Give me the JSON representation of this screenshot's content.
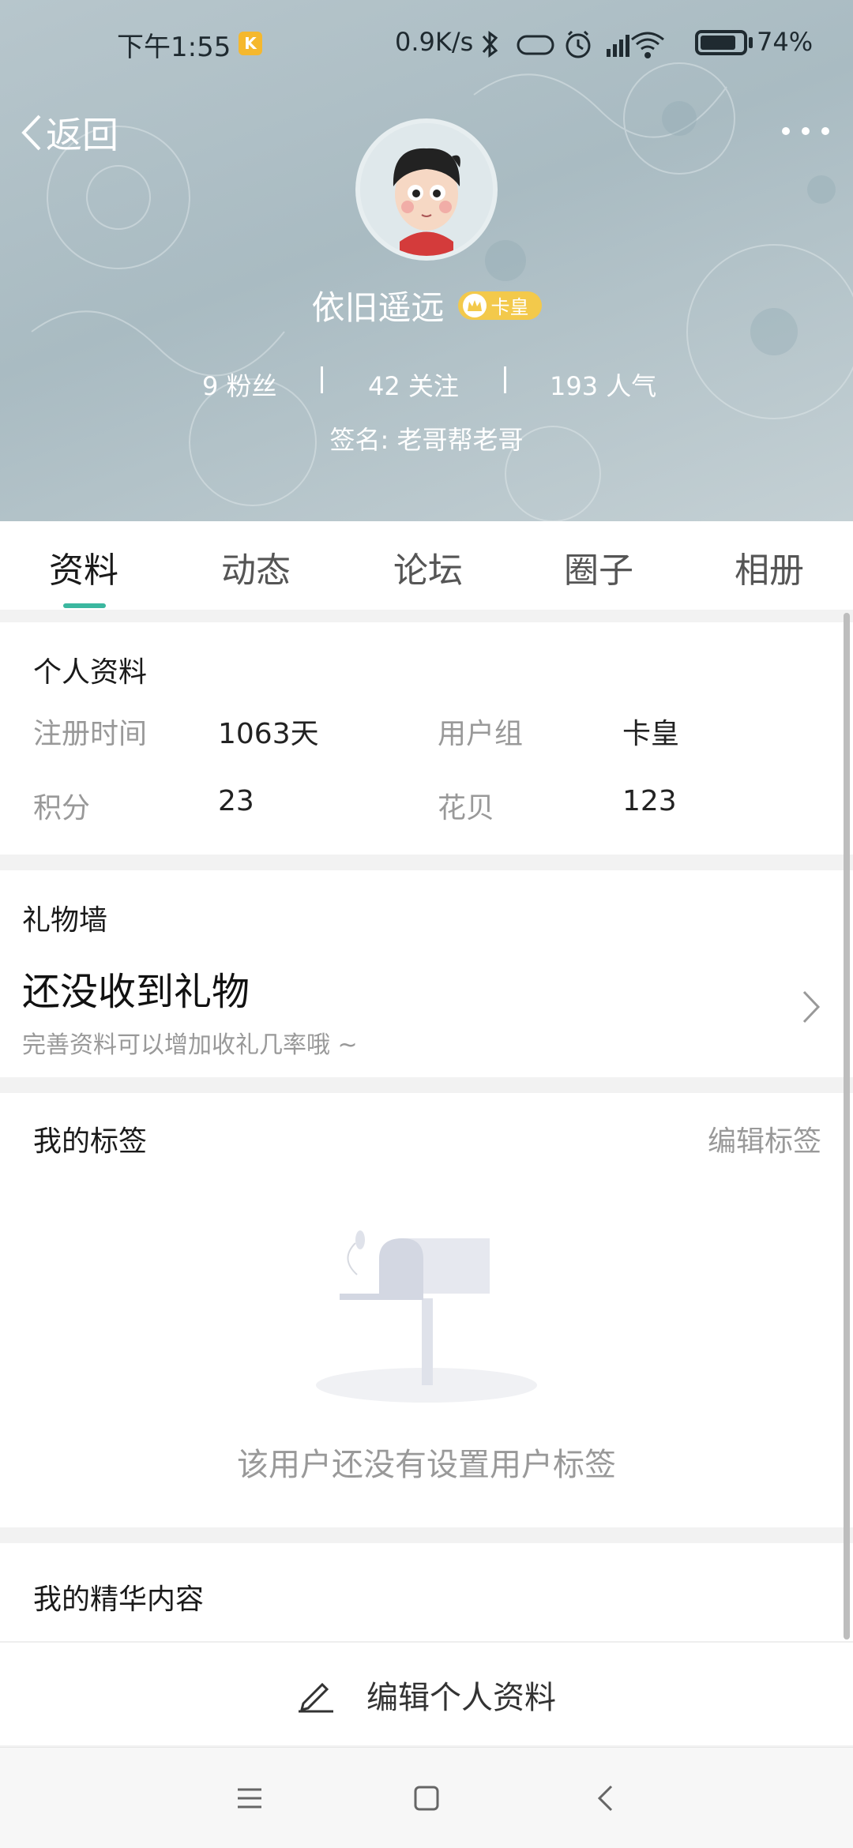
{
  "status_bar": {
    "time": "下午1:55",
    "k_badge": "K",
    "net_speed": "0.9K/s",
    "battery": "74%"
  },
  "header": {
    "back_label": "返回",
    "username": "依旧遥远",
    "badge_label": "卡皇",
    "stats": [
      {
        "value": "9",
        "label": "粉丝"
      },
      {
        "value": "42",
        "label": "关注"
      },
      {
        "value": "193",
        "label": "人气"
      }
    ],
    "stat_texts": [
      "9 粉丝",
      "42 关注",
      "193 人气"
    ],
    "signature": "签名: 老哥帮老哥"
  },
  "tabs": [
    "资料",
    "动态",
    "论坛",
    "圈子",
    "相册"
  ],
  "active_tab": "资料",
  "profile": {
    "title": "个人资料",
    "fields": [
      {
        "label": "注册时间",
        "value": "1063天"
      },
      {
        "label": "用户组",
        "value": "卡皇"
      },
      {
        "label": "积分",
        "value": "23"
      },
      {
        "label": "花贝",
        "value": "123"
      }
    ]
  },
  "gift_wall": {
    "title": "礼物墙",
    "headline": "还没收到礼物",
    "hint": "完善资料可以增加收礼几率哦 ~"
  },
  "tags": {
    "title": "我的标签",
    "edit_label": "编辑标签",
    "empty_text": "该用户还没有设置用户标签"
  },
  "featured": {
    "title": "我的精华内容"
  },
  "bottom_action": {
    "label": "编辑个人资料"
  },
  "colors": {
    "accent": "#3bb79f",
    "badge": "#f3c94b"
  }
}
